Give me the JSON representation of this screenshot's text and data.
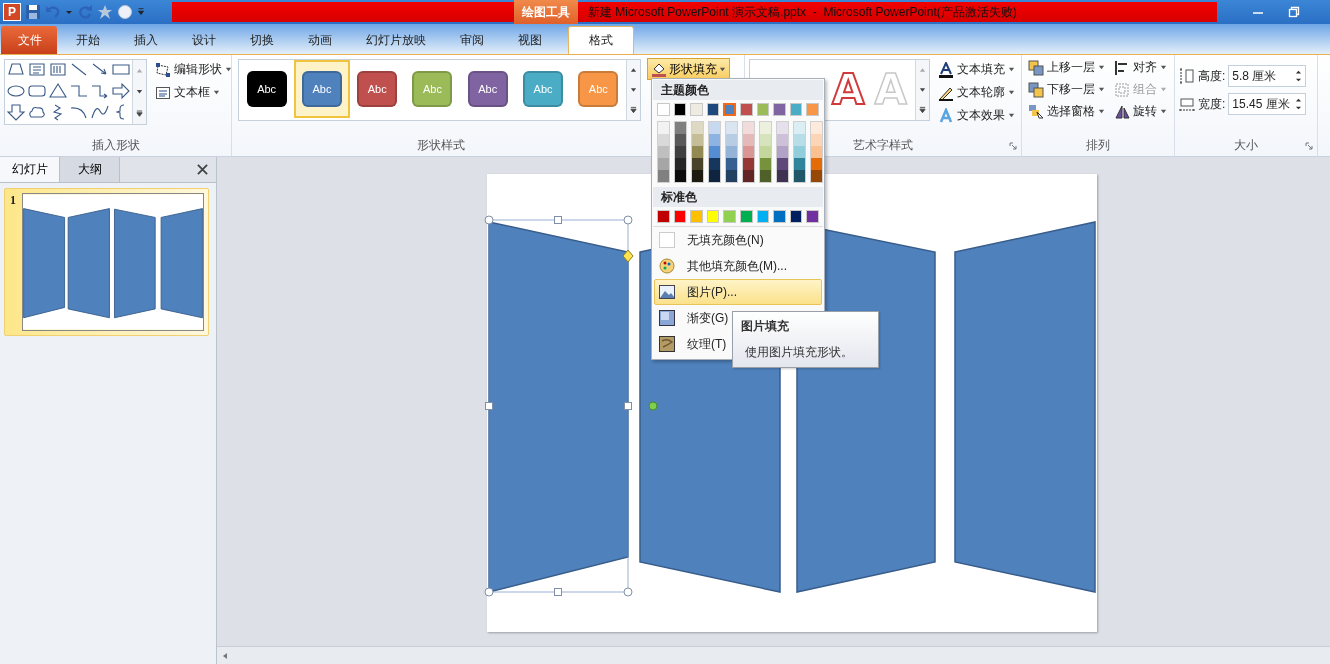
{
  "app_logo": "P",
  "title_bar": {
    "context_tab": "绘图工具",
    "title": "新建 Microsoft PowerPoint 演示文稿.pptx  -  Microsoft PowerPoint(产品激活失败)"
  },
  "tabs": [
    {
      "label": "文件",
      "kind": "file",
      "selected": false
    },
    {
      "label": "开始",
      "kind": "tab",
      "selected": false
    },
    {
      "label": "插入",
      "kind": "tab",
      "selected": false
    },
    {
      "label": "设计",
      "kind": "tab",
      "selected": false
    },
    {
      "label": "切换",
      "kind": "tab",
      "selected": false
    },
    {
      "label": "动画",
      "kind": "tab",
      "selected": false
    },
    {
      "label": "幻灯片放映",
      "kind": "tab",
      "selected": false
    },
    {
      "label": "审阅",
      "kind": "tab",
      "selected": false
    },
    {
      "label": "视图",
      "kind": "tab",
      "selected": false
    },
    {
      "label": "格式",
      "kind": "tab",
      "selected": true
    }
  ],
  "insert_shapes": {
    "label": "插入形状",
    "commands": [
      "编辑形状",
      "文本框"
    ]
  },
  "shape_styles": {
    "label": "形状样式",
    "styles": [
      {
        "text": "Abc",
        "color": "#000000",
        "selected": false
      },
      {
        "text": "Abc",
        "color": "#4f81bd",
        "selected": true
      },
      {
        "text": "Abc",
        "color": "#c0504d",
        "selected": false
      },
      {
        "text": "Abc",
        "color": "#9bbb59",
        "selected": false
      },
      {
        "text": "Abc",
        "color": "#8064a2",
        "selected": false
      },
      {
        "text": "Abc",
        "color": "#4bacc6",
        "selected": false
      },
      {
        "text": "Abc",
        "color": "#f79646",
        "selected": false
      }
    ],
    "fill_button": {
      "label": "形状填充",
      "expanded": true
    }
  },
  "wordart_styles": {
    "label": "艺术字样式",
    "samples": [
      {
        "text": "A",
        "kind": "red-outline"
      },
      {
        "text": "A",
        "kind": "white-outline"
      }
    ],
    "commands": [
      "文本填充",
      "文本轮廓",
      "文本效果"
    ]
  },
  "arrange": {
    "label": "排列",
    "commands": [
      {
        "label": "上移一层",
        "disabled": false
      },
      {
        "label": "对齐",
        "disabled": false
      },
      {
        "label": "下移一层",
        "disabled": false
      },
      {
        "label": "组合",
        "disabled": true
      },
      {
        "label": "选择窗格",
        "disabled": false
      },
      {
        "label": "旋转",
        "disabled": false
      }
    ]
  },
  "size": {
    "label": "大小",
    "height_label": "高度:",
    "height": "5.8 厘米",
    "width_label": "宽度:",
    "width": "15.45 厘米"
  },
  "fill_menu": {
    "theme_header": "主题颜色",
    "theme_colors": [
      {
        "color": "#ffffff",
        "selected": false,
        "shades": [
          {
            "color": "#f2f2f2"
          },
          {
            "color": "#d9d9d9"
          },
          {
            "color": "#bfbfbf"
          },
          {
            "color": "#a6a6a6"
          },
          {
            "color": "#808080"
          }
        ]
      },
      {
        "color": "#000000",
        "selected": false,
        "shades": [
          {
            "color": "#7f7f7f"
          },
          {
            "color": "#595959"
          },
          {
            "color": "#404040"
          },
          {
            "color": "#262626"
          },
          {
            "color": "#0d0d0d"
          }
        ]
      },
      {
        "color": "#eeece1",
        "selected": false,
        "shades": [
          {
            "color": "#ddd9c3"
          },
          {
            "color": "#c4bd97"
          },
          {
            "color": "#938953"
          },
          {
            "color": "#494429"
          },
          {
            "color": "#1d1b10"
          }
        ]
      },
      {
        "color": "#1f497d",
        "selected": false,
        "shades": [
          {
            "color": "#c6d9f0"
          },
          {
            "color": "#8db3e2"
          },
          {
            "color": "#548dd4"
          },
          {
            "color": "#17365d"
          },
          {
            "color": "#0f243e"
          }
        ]
      },
      {
        "color": "#4f81bd",
        "selected": true,
        "shades": [
          {
            "color": "#dbe5f1"
          },
          {
            "color": "#b8cce4"
          },
          {
            "color": "#95b3d7"
          },
          {
            "color": "#366092"
          },
          {
            "color": "#244061"
          }
        ]
      },
      {
        "color": "#c0504d",
        "selected": false,
        "shades": [
          {
            "color": "#f2dcdb"
          },
          {
            "color": "#e5b9b7"
          },
          {
            "color": "#d99694"
          },
          {
            "color": "#953734"
          },
          {
            "color": "#632423"
          }
        ]
      },
      {
        "color": "#9bbb59",
        "selected": false,
        "shades": [
          {
            "color": "#ebf1dd"
          },
          {
            "color": "#d7e3bc"
          },
          {
            "color": "#c3d69b"
          },
          {
            "color": "#76923c"
          },
          {
            "color": "#4f6128"
          }
        ]
      },
      {
        "color": "#8064a2",
        "selected": false,
        "shades": [
          {
            "color": "#e5e0ec"
          },
          {
            "color": "#ccc1d9"
          },
          {
            "color": "#b2a2c7"
          },
          {
            "color": "#5f497a"
          },
          {
            "color": "#3f3151"
          }
        ]
      },
      {
        "color": "#4bacc6",
        "selected": false,
        "shades": [
          {
            "color": "#dbeef3"
          },
          {
            "color": "#b7dde8"
          },
          {
            "color": "#92cddc"
          },
          {
            "color": "#31859b"
          },
          {
            "color": "#205867"
          }
        ]
      },
      {
        "color": "#f79646",
        "selected": false,
        "shades": [
          {
            "color": "#fdeada"
          },
          {
            "color": "#fbd5b5"
          },
          {
            "color": "#fac08f"
          },
          {
            "color": "#e36c09"
          },
          {
            "color": "#974806"
          }
        ]
      }
    ],
    "standard_header": "标准色",
    "standard_colors": [
      {
        "color": "#c00000"
      },
      {
        "color": "#ff0000"
      },
      {
        "color": "#ffc000"
      },
      {
        "color": "#ffff00"
      },
      {
        "color": "#92d050"
      },
      {
        "color": "#00b050"
      },
      {
        "color": "#00b0f0"
      },
      {
        "color": "#0070c0"
      },
      {
        "color": "#002060"
      },
      {
        "color": "#7030a0"
      }
    ],
    "items": [
      {
        "label": "无填充颜色(N)",
        "kind": "none",
        "selected": false
      },
      {
        "label": "其他填充颜色(M)...",
        "kind": "more",
        "selected": false
      },
      {
        "label": "图片(P)...",
        "kind": "picture",
        "selected": true
      },
      {
        "label": "渐变(G)",
        "kind": "gradient",
        "selected": false
      },
      {
        "label": "纹理(T)",
        "kind": "texture",
        "selected": false
      }
    ]
  },
  "tooltip": {
    "title": "图片填充",
    "text": "使用图片填充形状。"
  },
  "slides_panel": {
    "tabs": [
      {
        "label": "幻灯片",
        "selected": true
      },
      {
        "label": "大纲",
        "selected": false
      }
    ],
    "slides": [
      {
        "number": "1",
        "selected": true
      }
    ]
  }
}
